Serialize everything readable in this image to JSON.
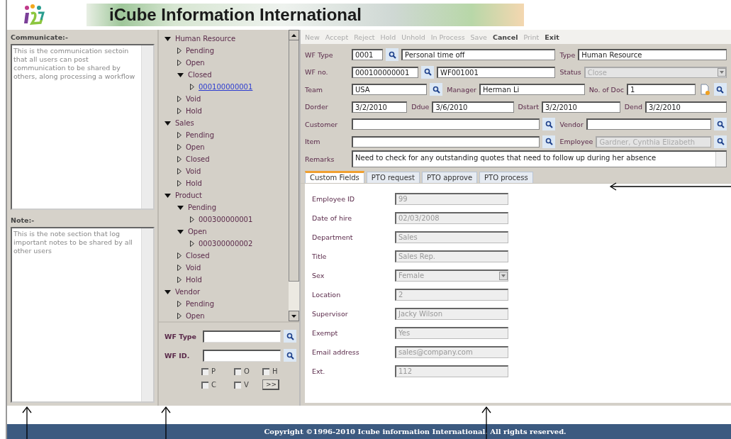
{
  "header": {
    "title": "iCube Information International"
  },
  "communicate": {
    "label": "Communicate:-",
    "text": "This is the communication sectoin that all users can post communication to be shared by others, along processing a workflow"
  },
  "note": {
    "label": "Note:-",
    "text": "This is the note section that log important notes to be shared by all other users"
  },
  "tree": [
    {
      "label": "Human Resource",
      "expanded": true,
      "children": [
        {
          "label": "Pending",
          "expanded": false
        },
        {
          "label": "Open",
          "expanded": false
        },
        {
          "label": "Closed",
          "expanded": true,
          "children": [
            {
              "label": "000100000001",
              "expanded": false,
              "kind": "link"
            }
          ]
        },
        {
          "label": "Void",
          "expanded": false
        },
        {
          "label": "Hold",
          "expanded": false
        }
      ]
    },
    {
      "label": "Sales",
      "expanded": true,
      "children": [
        {
          "label": "Pending",
          "expanded": false
        },
        {
          "label": "Open",
          "expanded": false
        },
        {
          "label": "Closed",
          "expanded": false
        },
        {
          "label": "Void",
          "expanded": false
        },
        {
          "label": "Hold",
          "expanded": false
        }
      ]
    },
    {
      "label": "Product",
      "expanded": true,
      "children": [
        {
          "label": "Pending",
          "expanded": true,
          "children": [
            {
              "label": "000300000001",
              "expanded": false,
              "kind": "plain"
            }
          ]
        },
        {
          "label": "Open",
          "expanded": true,
          "children": [
            {
              "label": "000300000002",
              "expanded": false,
              "kind": "plain"
            }
          ]
        },
        {
          "label": "Closed",
          "expanded": false
        },
        {
          "label": "Void",
          "expanded": false
        },
        {
          "label": "Hold",
          "expanded": false
        }
      ]
    },
    {
      "label": "Vendor",
      "expanded": true,
      "children": [
        {
          "label": "Pending",
          "expanded": false
        },
        {
          "label": "Open",
          "expanded": false
        }
      ]
    }
  ],
  "search": {
    "fields": [
      {
        "label": "WF Type"
      },
      {
        "label": "WF ID."
      }
    ],
    "checkboxes": [
      {
        "label": "P",
        "checked": false
      },
      {
        "label": "O",
        "checked": false
      },
      {
        "label": "H",
        "checked": false
      },
      {
        "label": "C",
        "checked": false
      },
      {
        "label": "V",
        "checked": false
      }
    ],
    "button": ">>"
  },
  "toolbar": [
    {
      "label": "New",
      "disabled": true
    },
    {
      "label": "Accept",
      "disabled": true
    },
    {
      "label": "Reject",
      "disabled": true
    },
    {
      "label": "Hold",
      "disabled": true
    },
    {
      "label": "Unhold",
      "disabled": true
    },
    {
      "label": "In Process",
      "disabled": true
    },
    {
      "label": "Save",
      "disabled": true
    },
    {
      "label": "Cancel",
      "disabled": false
    },
    {
      "label": "Print",
      "disabled": true
    },
    {
      "label": "Exit",
      "disabled": false
    }
  ],
  "form": {
    "rows": [
      {
        "fields": [
          {
            "label": "WF Type",
            "parts": [
              {
                "kind": "code",
                "value": "0001",
                "disabled": false
              },
              {
                "kind": "lookup",
                "disabled": false
              },
              {
                "kind": "text",
                "value": "Personal time off",
                "disabled": false
              }
            ]
          },
          {
            "label": "Type",
            "parts": [
              {
                "kind": "text",
                "value": "Human Resource",
                "disabled": false
              }
            ]
          }
        ]
      },
      {
        "fields": [
          {
            "label": "WF no.",
            "parts": [
              {
                "kind": "number",
                "value": "000100000001",
                "disabled": false
              },
              {
                "kind": "lookup",
                "disabled": false
              },
              {
                "kind": "text",
                "value": "WF001001",
                "disabled": false
              }
            ]
          },
          {
            "label": "Status",
            "parts": [
              {
                "kind": "select",
                "value": "Close",
                "disabled": true
              }
            ]
          }
        ]
      },
      {
        "fields": [
          {
            "label": "Team",
            "parts": [
              {
                "kind": "text",
                "value": "USA",
                "disabled": false
              },
              {
                "kind": "lookup",
                "disabled": false
              }
            ]
          },
          {
            "label": "Manager",
            "parts": [
              {
                "kind": "text",
                "value": "Herman Li",
                "disabled": false
              }
            ]
          },
          {
            "label": "No. of Doc",
            "parts": [
              {
                "kind": "text",
                "value": "1",
                "disabled": false
              },
              {
                "kind": "doc",
                "disabled": false
              },
              {
                "kind": "lookup",
                "disabled": false
              }
            ]
          }
        ]
      },
      {
        "fields": [
          {
            "label": "Dorder",
            "parts": [
              {
                "kind": "text",
                "value": "3/2/2010",
                "disabled": false
              }
            ]
          },
          {
            "label": "Ddue",
            "parts": [
              {
                "kind": "text",
                "value": "3/6/2010",
                "disabled": false
              }
            ]
          },
          {
            "label": "Dstart",
            "parts": [
              {
                "kind": "text",
                "value": "3/2/2010",
                "disabled": false
              }
            ]
          },
          {
            "label": "Dend",
            "parts": [
              {
                "kind": "text",
                "value": "3/2/2010",
                "disabled": false
              }
            ]
          }
        ]
      },
      {
        "fields": [
          {
            "label": "Customer",
            "parts": [
              {
                "kind": "text",
                "disabled": false
              },
              {
                "kind": "lookup",
                "disabled": false
              }
            ]
          },
          {
            "label": "Vendor",
            "parts": [
              {
                "kind": "text",
                "disabled": false
              },
              {
                "kind": "lookup",
                "disabled": false
              }
            ]
          }
        ]
      },
      {
        "fields": [
          {
            "label": "Item",
            "parts": [
              {
                "kind": "text",
                "disabled": false
              },
              {
                "kind": "lookup",
                "disabled": false
              }
            ]
          },
          {
            "label": "Employee",
            "parts": [
              {
                "kind": "text",
                "value": "Gardner, Cynthia Elizabeth",
                "disabled": true
              },
              {
                "kind": "lookup",
                "disabled": false
              }
            ]
          }
        ]
      },
      {
        "fields": [
          {
            "label": "Remarks",
            "parts": [
              {
                "kind": "memo",
                "value": "Need to check for any outstanding quotes that need to follow up during her absence",
                "disabled": false
              }
            ]
          }
        ]
      }
    ]
  },
  "custom": {
    "tabs": [
      {
        "label": "Custom Fields",
        "selected": true
      },
      {
        "label": "PTO request",
        "selected": false
      },
      {
        "label": "PTO approve",
        "selected": false
      },
      {
        "label": "PTO process",
        "selected": false
      }
    ],
    "fields": [
      {
        "label": "Employee ID",
        "value": "99",
        "kind": "text"
      },
      {
        "label": "Date of hire",
        "value": "02/03/2008",
        "kind": "text"
      },
      {
        "label": "Department",
        "value": "Sales",
        "kind": "text"
      },
      {
        "label": "Title",
        "value": "Sales Rep.",
        "kind": "text"
      },
      {
        "label": "Sex",
        "value": "Female",
        "kind": "select"
      },
      {
        "label": "Location",
        "value": "2",
        "kind": "text"
      },
      {
        "label": "Supervisor",
        "value": "Jacky Wilson",
        "kind": "text"
      },
      {
        "label": "Exempt",
        "value": "Yes",
        "kind": "text"
      },
      {
        "label": "Email address",
        "value": "sales@company.com",
        "kind": "text"
      },
      {
        "label": "Ext.",
        "value": "112",
        "kind": "text"
      }
    ]
  },
  "footer": {
    "copyright": "Copyright ©1996-2010 Icube information International. All rights reserved."
  }
}
